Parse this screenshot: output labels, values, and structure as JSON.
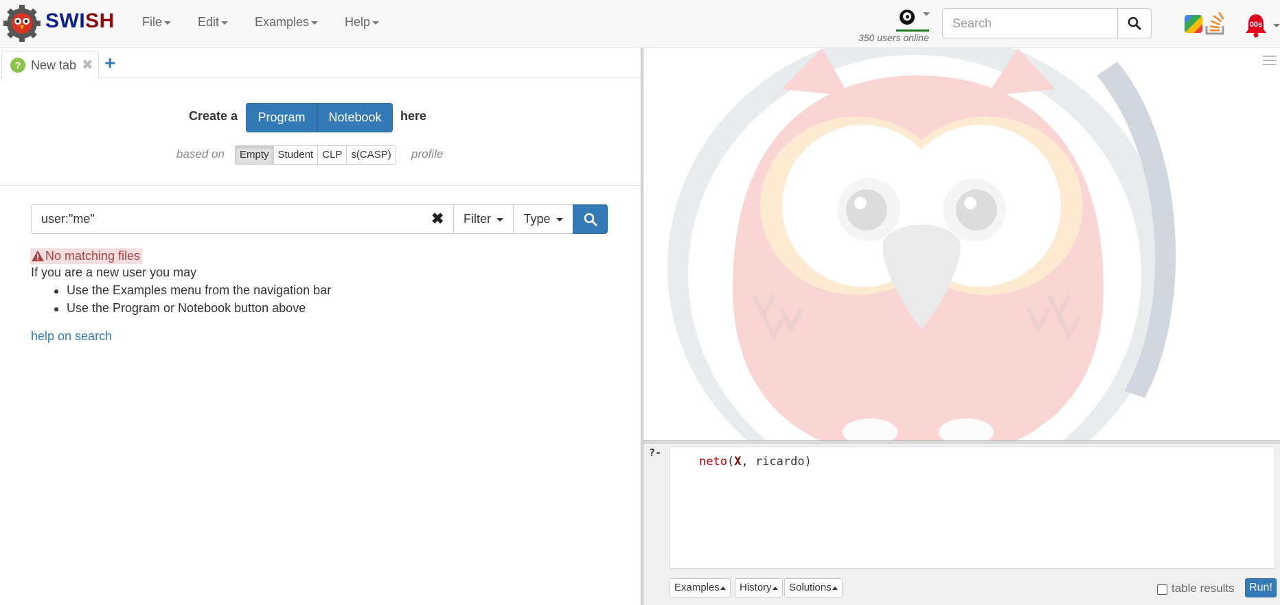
{
  "navbar": {
    "brand": {
      "part1": "SWI",
      "part2": "SH"
    },
    "menus": [
      {
        "label": "File"
      },
      {
        "label": "Edit"
      },
      {
        "label": "Examples"
      },
      {
        "label": "Help"
      }
    ],
    "users_online": "350 users online",
    "search": {
      "placeholder": "Search",
      "value": ""
    },
    "notification_badge": "00s"
  },
  "left": {
    "tab": {
      "label": "New tab",
      "icon": "?"
    },
    "create": {
      "prefix": "Create a",
      "program_label": "Program",
      "notebook_label": "Notebook",
      "suffix": "here",
      "based_on": "based on",
      "profiles": [
        {
          "label": "Empty",
          "active": true
        },
        {
          "label": "Student",
          "active": false
        },
        {
          "label": "CLP",
          "active": false
        },
        {
          "label": "s(CASP)",
          "active": false
        }
      ],
      "profile_suffix": "profile"
    },
    "file_search": {
      "query": "user:\"me\"",
      "filter_label": "Filter",
      "type_label": "Type"
    },
    "no_match": "No matching files",
    "new_user_text": "If you are a new user you may",
    "tips": [
      "Use the Examples menu from the navigation bar",
      "Use the Program or Notebook button above"
    ],
    "help_link": "help on search"
  },
  "query": {
    "prompt": "?-",
    "tokens": {
      "functor": "neto",
      "open": "(",
      "var": "X",
      "comma": ", ",
      "atom": "ricardo",
      "close": ")"
    },
    "buttons": {
      "examples": "Examples",
      "history": "History",
      "solutions": "Solutions"
    },
    "table_results_label": "table results",
    "table_results_checked": false,
    "run_label": "Run!"
  },
  "colors": {
    "brand_blue": "#0b1f8f",
    "brand_red": "#8b0d10",
    "primary": "#337ab7",
    "error": "#a94442",
    "functor": "#c00000",
    "variable": "#8b0000",
    "atom": "#333333"
  }
}
